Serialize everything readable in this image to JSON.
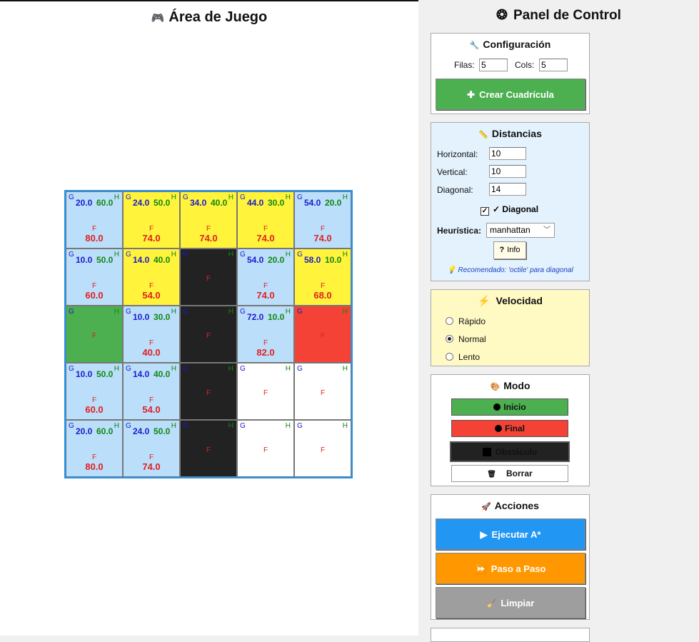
{
  "game": {
    "title": "Área de Juego",
    "title_icon": "🎮",
    "labels": {
      "g": "G",
      "h": "H",
      "f": "F"
    },
    "grid": {
      "rows": 5,
      "cols": 5,
      "cells": [
        [
          {
            "type": "open",
            "g": "20.0",
            "h": "60.0",
            "f": "80.0"
          },
          {
            "type": "closed",
            "g": "24.0",
            "h": "50.0",
            "f": "74.0"
          },
          {
            "type": "closed",
            "g": "34.0",
            "h": "40.0",
            "f": "74.0"
          },
          {
            "type": "closed",
            "g": "44.0",
            "h": "30.0",
            "f": "74.0"
          },
          {
            "type": "open",
            "g": "54.0",
            "h": "20.0",
            "f": "74.0"
          }
        ],
        [
          {
            "type": "open",
            "g": "10.0",
            "h": "50.0",
            "f": "60.0"
          },
          {
            "type": "closed",
            "g": "14.0",
            "h": "40.0",
            "f": "54.0"
          },
          {
            "type": "obstacle",
            "g": "",
            "h": "",
            "f": ""
          },
          {
            "type": "open",
            "g": "54.0",
            "h": "20.0",
            "f": "74.0"
          },
          {
            "type": "closed",
            "g": "58.0",
            "h": "10.0",
            "f": "68.0"
          }
        ],
        [
          {
            "type": "start",
            "g": "",
            "h": "",
            "f": ""
          },
          {
            "type": "open",
            "g": "10.0",
            "h": "30.0",
            "f": "40.0"
          },
          {
            "type": "obstacle",
            "g": "",
            "h": "",
            "f": ""
          },
          {
            "type": "open",
            "g": "72.0",
            "h": "10.0",
            "f": "82.0"
          },
          {
            "type": "end",
            "g": "",
            "h": "",
            "f": ""
          }
        ],
        [
          {
            "type": "open",
            "g": "10.0",
            "h": "50.0",
            "f": "60.0"
          },
          {
            "type": "open",
            "g": "14.0",
            "h": "40.0",
            "f": "54.0"
          },
          {
            "type": "obstacle",
            "g": "",
            "h": "",
            "f": ""
          },
          {
            "type": "empty",
            "g": "",
            "h": "",
            "f": ""
          },
          {
            "type": "empty",
            "g": "",
            "h": "",
            "f": ""
          }
        ],
        [
          {
            "type": "open",
            "g": "20.0",
            "h": "60.0",
            "f": "80.0"
          },
          {
            "type": "open",
            "g": "24.0",
            "h": "50.0",
            "f": "74.0"
          },
          {
            "type": "obstacle",
            "g": "",
            "h": "",
            "f": ""
          },
          {
            "type": "empty",
            "g": "",
            "h": "",
            "f": ""
          },
          {
            "type": "empty",
            "g": "",
            "h": "",
            "f": ""
          }
        ]
      ]
    }
  },
  "panel": {
    "title": "Panel de Control",
    "title_icon": "❂",
    "config": {
      "title": "Configuración",
      "icon": "wrench-icon",
      "icon_glyph": "🔧",
      "rows_label": "Filas:",
      "rows_value": "5",
      "cols_label": "Cols:",
      "cols_value": "5",
      "create_icon": "✚",
      "create_label": "Crear Cuadrícula"
    },
    "distances": {
      "title": "Distancias",
      "icon_glyph": "📏",
      "horizontal_label": "Horizontal:",
      "horizontal_value": "10",
      "vertical_label": "Vertical:",
      "vertical_value": "10",
      "diagonal_label": "Diagonal:",
      "diagonal_value": "14",
      "diag_check_label": "✓ Diagonal",
      "diag_checked": true,
      "heuristic_label": "Heurística:",
      "heuristic_value": "manhattan",
      "info_icon": "?",
      "info_label": "Info",
      "hint": "💡 Recomendado: 'octile' para diagonal"
    },
    "speed": {
      "title": "Velocidad",
      "icon_glyph": "⚡",
      "options": [
        "Rápido",
        "Normal",
        "Lento"
      ],
      "selected": "Normal"
    },
    "mode": {
      "title": "Modo",
      "icon_glyph": "🎨",
      "start_label": "Inicio",
      "end_label": "Final",
      "obstacle_label": "Obstáculo",
      "erase_icon": "🗑",
      "erase_label": "Borrar"
    },
    "actions": {
      "title": "Acciones",
      "icon_glyph": "🚀",
      "run_icon": "▶",
      "run_label": "Ejecutar A*",
      "step_icon": "⏩",
      "step_label": "Paso a Paso",
      "clear_icon": "🧹",
      "clear_label": "Limpiar"
    },
    "colors": {
      "green": "#4caf50",
      "red": "#f44336",
      "blue": "#2196f3",
      "orange": "#ff9800",
      "gray": "#9e9e9e",
      "yellow_panel": "#fff9c4",
      "blue_panel": "#e3f2fd"
    }
  }
}
